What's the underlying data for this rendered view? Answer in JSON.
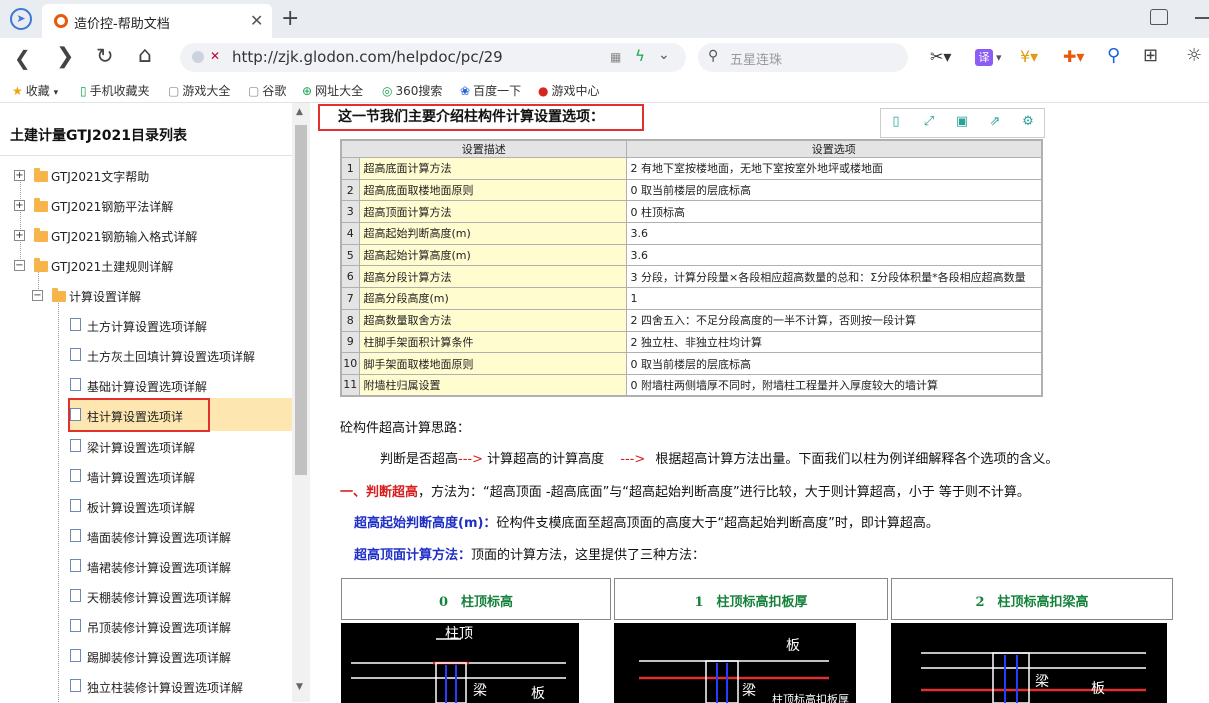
{
  "browser": {
    "tab_title": "造价控-帮助文档",
    "tab_close": "✕",
    "new_tab": "+",
    "url": "http://zjk.glodon.com/helpdoc/pc/29",
    "search_placeholder": "五星连珠",
    "translate_label": "译",
    "bookmarks": [
      {
        "icon": "star-icon",
        "label": "收藏"
      },
      {
        "icon": "phone-icon",
        "label": "手机收藏夹"
      },
      {
        "icon": "page-icon",
        "label": "游戏大全"
      },
      {
        "icon": "page-icon",
        "label": "谷歌"
      },
      {
        "icon": "globe-icon",
        "label": "网址大全"
      },
      {
        "icon": "360-icon",
        "label": "360搜索"
      },
      {
        "icon": "baidu-icon",
        "label": "百度一下"
      },
      {
        "icon": "game-icon",
        "label": "游戏中心"
      }
    ]
  },
  "sidebar": {
    "title": "土建计量GTJ2021目录列表",
    "nodes": [
      {
        "label": "GTJ2021文字帮助"
      },
      {
        "label": "GTJ2021钢筋平法详解"
      },
      {
        "label": "GTJ2021钢筋输入格式详解"
      },
      {
        "label": "GTJ2021土建规则详解"
      },
      {
        "label": "计算设置详解"
      },
      {
        "label": "土方计算设置选项详解"
      },
      {
        "label": "土方灰土回填计算设置选项详解"
      },
      {
        "label": "基础计算设置选项详解"
      },
      {
        "label": "柱计算设置选项详"
      },
      {
        "label": "梁计算设置选项详解"
      },
      {
        "label": "墙计算设置选项详解"
      },
      {
        "label": "板计算设置选项详解"
      },
      {
        "label": "墙面装修计算设置选项详解"
      },
      {
        "label": "墙裙装修计算设置选项详解"
      },
      {
        "label": "天棚装修计算设置选项详解"
      },
      {
        "label": "吊顶装修计算设置选项详解"
      },
      {
        "label": "踢脚装修计算设置选项详解"
      },
      {
        "label": "独立柱装修计算设置选项详解"
      }
    ]
  },
  "content": {
    "heading": "这一节我们主要介绍柱构件计算设置选项：",
    "table": {
      "headers": [
        "设置描述",
        "设置选项"
      ],
      "rows": [
        {
          "num": "1",
          "desc": "超高底面计算方法",
          "opt": "2 有地下室按楼地面，无地下室按室外地坪或楼地面"
        },
        {
          "num": "2",
          "desc": "超高底面取楼地面原则",
          "opt": "0 取当前楼层的层底标高"
        },
        {
          "num": "3",
          "desc": "超高顶面计算方法",
          "opt": "0 柱顶标高"
        },
        {
          "num": "4",
          "desc": "超高起始判断高度(m)",
          "opt": "3.6"
        },
        {
          "num": "5",
          "desc": "超高起始计算高度(m)",
          "opt": "3.6"
        },
        {
          "num": "6",
          "desc": "超高分段计算方法",
          "opt": "3 分段，计算分段量×各段相应超高数量的总和：Σ分段体积量*各段相应超高数量"
        },
        {
          "num": "7",
          "desc": "超高分段高度(m)",
          "opt": "1"
        },
        {
          "num": "8",
          "desc": "超高数量取舍方法",
          "opt": "2 四舍五入：不足分段高度的一半不计算，否则按一段计算"
        },
        {
          "num": "9",
          "desc": "柱脚手架面积计算条件",
          "opt": "2 独立柱、非独立柱均计算"
        },
        {
          "num": "10",
          "desc": "脚手架面取楼地面原则",
          "opt": "0 取当前楼层的层底标高"
        },
        {
          "num": "11",
          "desc": "附墙柱归属设置",
          "opt": "0 附墙柱两侧墙厚不同时，附墙柱工程量并入厚度较大的墙计算"
        }
      ]
    },
    "p1": "砼构件超高计算思路：",
    "p2_a": "判断是否超高",
    "p2_arrow1": "--->",
    "p2_b": " 计算超高的计算高度 ",
    "p2_arrow2": "--->",
    "p2_c": " 根据超高计算方法出量。下面我们以柱为例详细解释各个选项的含义。",
    "p3_label": "一、判断超高",
    "p3_text": "，方法为：“超高顶面 -超高底面”与“超高起始判断高度”进行比较，大于则计算超高，小于 等于则不计算。",
    "p4_label": "超高起始判断高度(m)：",
    "p4_text": "砼构件支模底面至超高顶面的高度大于“超高起始判断高度”时，即计算超高。",
    "p5_label": "超高顶面计算方法：",
    "p5_text": "顶面的计算方法，这里提供了三种方法：",
    "methods": [
      {
        "title": "0　柱顶标高"
      },
      {
        "title": "1　柱顶标高扣板厚"
      },
      {
        "title": "2　柱顶标高扣梁高"
      }
    ],
    "diagram_labels": {
      "d1_top": "柱顶",
      "d1_beam": "梁",
      "d1_slab": "板",
      "d2_slab": "板",
      "d2_beam": "梁",
      "d2_note": "柱顶标高扣板厚",
      "d3_slab": "板",
      "d3_beam": "梁"
    }
  },
  "colors": {
    "highlight_border": "#e0312e",
    "selected_bg": "#fde6b0",
    "desc_bg": "#fffcd0",
    "method_title": "#15813b"
  }
}
